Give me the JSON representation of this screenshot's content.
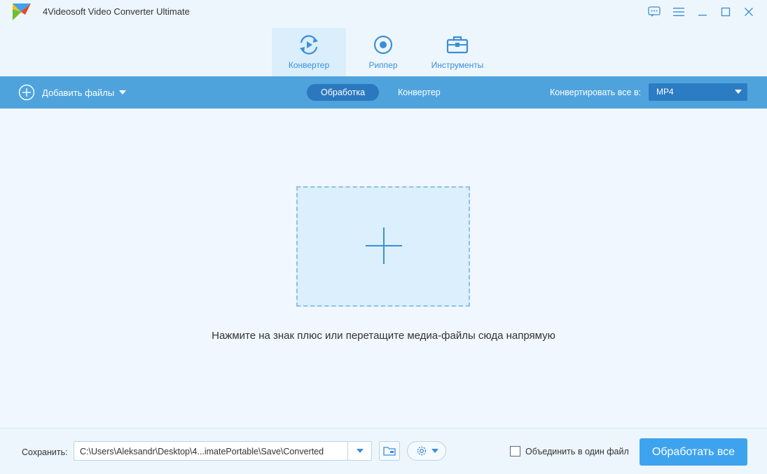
{
  "window": {
    "title": "4Videosoft Video Converter Ultimate",
    "controls": [
      "chat-icon",
      "menu-icon",
      "minimize-icon",
      "maximize-icon",
      "close-icon"
    ]
  },
  "modes": [
    {
      "label": "Конвертер",
      "icon": "convert-icon",
      "active": true
    },
    {
      "label": "Риппер",
      "icon": "disc-icon",
      "active": false
    },
    {
      "label": "Инструменты",
      "icon": "toolbox-icon",
      "active": false
    }
  ],
  "toolbar": {
    "add_files_label": "Добавить файлы",
    "subtabs": [
      {
        "label": "Обработка",
        "active": true
      },
      {
        "label": "Конвертер",
        "active": false
      }
    ],
    "convert_all_label": "Конвертировать все в:",
    "format_value": "MP4"
  },
  "main": {
    "hint": "Нажмите на знак плюс или перетащите медиа-файлы сюда напрямую"
  },
  "bottom": {
    "save_label": "Сохранить:",
    "save_path": "C:\\Users\\Aleksandr\\Desktop\\4...imatePortable\\Save\\Converted",
    "merge_label": "Объединить в один файл",
    "merge_checked": false,
    "process_all_label": "Обработать все"
  },
  "colors": {
    "accent": "#3ea3ee",
    "toolbar": "#4fa3dd",
    "active_subtab": "#2b78bf",
    "background": "#eef6fd"
  }
}
